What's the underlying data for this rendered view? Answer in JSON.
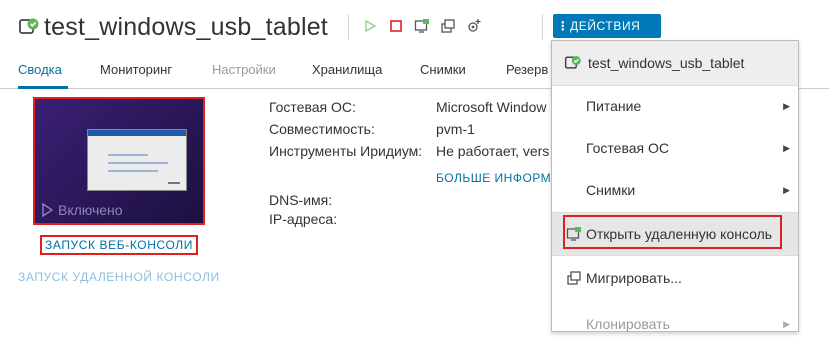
{
  "header": {
    "vm_name": "test_windows_usb_tablet",
    "actions_label": "ДЕЙСТВИЯ"
  },
  "tabs": [
    "Сводка",
    "Мониторинг",
    "Настройки",
    "Хранилища",
    "Снимки",
    "Резерв"
  ],
  "console": {
    "status": "Включено",
    "web_console_link": "ЗАПУСК ВЕБ-КОНСОЛИ",
    "remote_console_link": "ЗАПУСК УДАЛЕННОЙ КОНСОЛИ"
  },
  "info": {
    "guest_os_label": "Гостевая ОС:",
    "guest_os_value": "Microsoft Window",
    "compat_label": "Совместимость:",
    "compat_value": "pvm-1",
    "tools_label": "Инструменты Иридиум:",
    "tools_value": "Не работает, vers",
    "more_link": "БОЛЬШЕ ИНФОРМ",
    "dns_label": "DNS-имя:",
    "ip_label": "IP-адреса:"
  },
  "menu": {
    "header": "test_windows_usb_tablet",
    "items": [
      {
        "label": "Питание",
        "submenu": true
      },
      {
        "label": "Гостевая ОС",
        "submenu": true
      },
      {
        "label": "Снимки",
        "submenu": true
      },
      {
        "label": "Открыть удаленную консоль",
        "submenu": false
      },
      {
        "label": "Мигрировать...",
        "submenu": false
      },
      {
        "label": "Клонировать",
        "submenu": true
      }
    ]
  },
  "colors": {
    "accent": "#0072a3",
    "actions_bg": "#0079b8",
    "highlight_border": "#e0201e",
    "power_on": "#5cb85c",
    "stop": "#e0201e"
  }
}
